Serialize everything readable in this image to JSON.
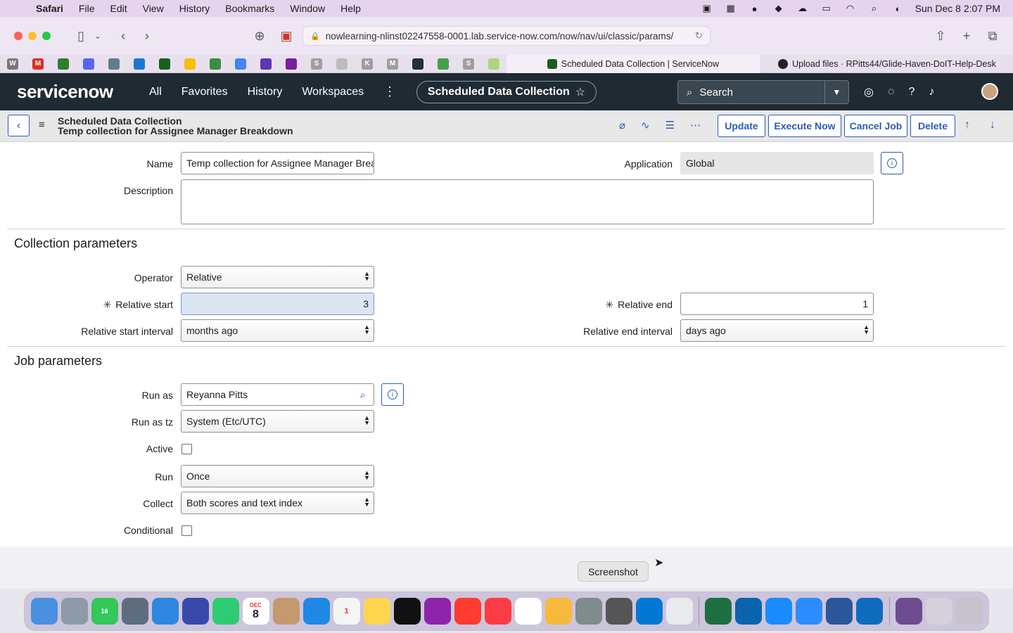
{
  "menubar": {
    "app_name": "Safari",
    "items": [
      "File",
      "Edit",
      "View",
      "History",
      "Bookmarks",
      "Window",
      "Help"
    ],
    "clock": "Sun Dec 8  2:07 PM"
  },
  "browser": {
    "url": "nowlearning-nlinst02247558-0001.lab.service-now.com/now/nav/ui/classic/params/",
    "tabs": [
      {
        "label": "Scheduled Data Collection | ServiceNow"
      },
      {
        "label": "Upload files · RPitts44/Glide-Haven-DoIT-Help-Desk"
      }
    ]
  },
  "sn_header": {
    "logo": "servicenow",
    "nav": [
      "All",
      "Favorites",
      "History",
      "Workspaces"
    ],
    "context": "Scheduled Data Collection",
    "search_placeholder": "Search"
  },
  "form_header": {
    "title_line1": "Scheduled Data Collection",
    "title_line2": "Temp collection for Assignee Manager Breakdown",
    "buttons": [
      "Update",
      "Execute Now",
      "Cancel Job",
      "Delete"
    ]
  },
  "form": {
    "name_label": "Name",
    "name_value": "Temp collection for Assignee Manager Brea",
    "application_label": "Application",
    "application_value": "Global",
    "description_label": "Description",
    "description_value": "",
    "collection_section": "Collection parameters",
    "operator_label": "Operator",
    "operator_value": "Relative",
    "relative_start_label": "Relative start",
    "relative_start_value": "3",
    "relative_end_label": "Relative end",
    "relative_end_value": "1",
    "relative_start_interval_label": "Relative start interval",
    "relative_start_interval_value": "months ago",
    "relative_end_interval_label": "Relative end interval",
    "relative_end_interval_value": "days ago",
    "job_section": "Job parameters",
    "run_as_label": "Run as",
    "run_as_value": "Reyanna Pitts",
    "run_as_tz_label": "Run as tz",
    "run_as_tz_value": "System (Etc/UTC)",
    "active_label": "Active",
    "run_label": "Run",
    "run_value": "Once",
    "collect_label": "Collect",
    "collect_value": "Both scores and text index",
    "conditional_label": "Conditional"
  },
  "tooltip": "Screenshot",
  "dock": {
    "calendar_month": "DEC",
    "calendar_day": "8",
    "messages_badge": "16",
    "reminders_badge": "1"
  },
  "colors": {
    "sn_header_bg": "#1f2a33",
    "accent": "#2d5bb5",
    "menubar_bg": "#e6d3ee"
  }
}
